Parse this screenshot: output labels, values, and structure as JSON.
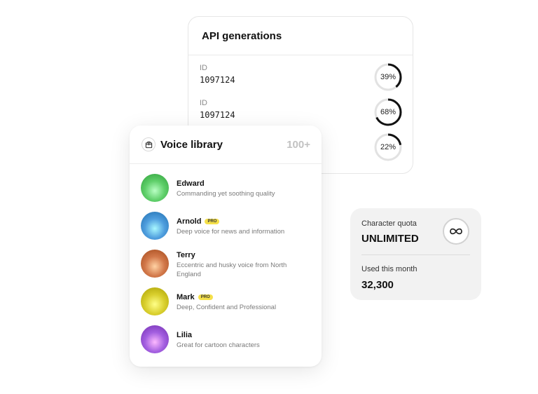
{
  "api_generations": {
    "title": "API generations",
    "rows": [
      {
        "id_label": "ID",
        "id_value": "1097124",
        "progress_label": "39%",
        "progress": 0.39
      },
      {
        "id_label": "ID",
        "id_value": "1097124",
        "progress_label": "68%",
        "progress": 0.68
      },
      {
        "progress_label": "22%",
        "progress": 0.22
      }
    ]
  },
  "voice_library": {
    "title": "Voice library",
    "count": "100+",
    "icon": "package-icon",
    "voices": [
      {
        "name": "Edward",
        "description": "Commanding yet soothing quality",
        "pro": false,
        "color": "#5fcf6a"
      },
      {
        "name": "Arnold",
        "badge": "PRO",
        "description": "Deep voice for news and information",
        "pro": true,
        "color": "#4f9ede"
      },
      {
        "name": "Terry",
        "description": "Eccentric and husky voice from North England",
        "pro": false,
        "color": "#d2784a"
      },
      {
        "name": "Mark",
        "badge": "PRO",
        "description": "Deep, Confident and Professional",
        "pro": true,
        "color": "#d9cf2e"
      },
      {
        "name": "Lilia",
        "description": "Great for cartoon characters",
        "pro": false,
        "color": "#a35fe0"
      }
    ]
  },
  "character_quota": {
    "label": "Character quota",
    "value": "UNLIMITED",
    "icon": "infinity-icon",
    "used_label": "Used this month",
    "used_value": "32,300"
  }
}
